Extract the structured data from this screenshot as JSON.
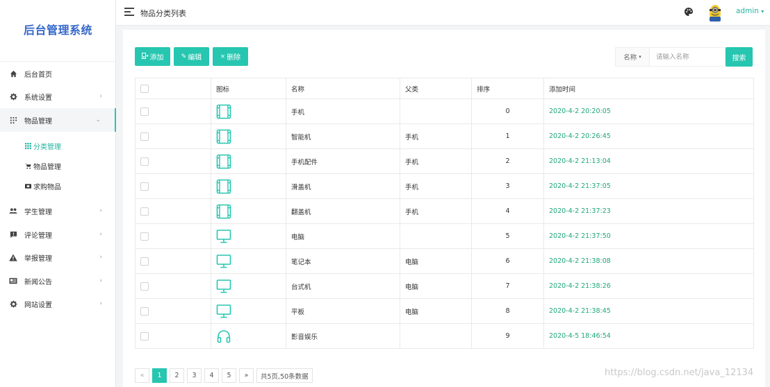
{
  "app": {
    "title": "后台管理系统"
  },
  "sidebar": {
    "items": [
      {
        "label": "后台首页",
        "icon": "home-icon"
      },
      {
        "label": "系统设置",
        "icon": "gear-icon"
      },
      {
        "label": "物品管理",
        "icon": "grid-icon"
      },
      {
        "label": "学生管理",
        "icon": "users-icon"
      },
      {
        "label": "评论管理",
        "icon": "comment-icon"
      },
      {
        "label": "举报管理",
        "icon": "warning-icon"
      },
      {
        "label": "新闻公告",
        "icon": "news-icon"
      },
      {
        "label": "网站设置",
        "icon": "gear-icon"
      }
    ],
    "sub_items": [
      {
        "label": "分类管理",
        "icon": "grid-small-icon"
      },
      {
        "label": "物品管理",
        "icon": "cart-icon"
      },
      {
        "label": "求购物品",
        "icon": "ticket-icon"
      }
    ]
  },
  "header": {
    "title": "物品分类列表",
    "user": "admin"
  },
  "toolbar": {
    "add_label": "添加",
    "edit_label": "编辑",
    "delete_label": "删除"
  },
  "search": {
    "category": "名称",
    "placeholder": "请输入名称",
    "button": "搜索"
  },
  "table": {
    "columns": [
      "图标",
      "名称",
      "父类",
      "排序",
      "添加时间"
    ],
    "rows": [
      {
        "icon": "tablet-icon",
        "name": "手机",
        "parent": "",
        "sort": "0",
        "time": "2020-4-2 20:20:05"
      },
      {
        "icon": "tablet-icon",
        "name": "智能机",
        "parent": "手机",
        "sort": "1",
        "time": "2020-4-2 20:26:45"
      },
      {
        "icon": "tablet-icon",
        "name": "手机配件",
        "parent": "手机",
        "sort": "2",
        "time": "2020-4-2 21:13:04"
      },
      {
        "icon": "tablet-icon",
        "name": "滑盖机",
        "parent": "手机",
        "sort": "3",
        "time": "2020-4-2 21:37:05"
      },
      {
        "icon": "tablet-icon",
        "name": "翻盖机",
        "parent": "手机",
        "sort": "4",
        "time": "2020-4-2 21:37:23"
      },
      {
        "icon": "monitor-icon",
        "name": "电脑",
        "parent": "",
        "sort": "5",
        "time": "2020-4-2 21:37:50"
      },
      {
        "icon": "monitor-icon",
        "name": "笔记本",
        "parent": "电脑",
        "sort": "6",
        "time": "2020-4-2 21:38:08"
      },
      {
        "icon": "monitor-icon",
        "name": "台式机",
        "parent": "电脑",
        "sort": "7",
        "time": "2020-4-2 21:38:26"
      },
      {
        "icon": "monitor-icon",
        "name": "平板",
        "parent": "电脑",
        "sort": "8",
        "time": "2020-4-2 21:38:45"
      },
      {
        "icon": "headphones-icon",
        "name": "影音娱乐",
        "parent": "",
        "sort": "9",
        "time": "2020-4-5 18:46:54"
      }
    ]
  },
  "pagination": {
    "prev": "«",
    "pages": [
      "1",
      "2",
      "3",
      "4",
      "5"
    ],
    "next": "»",
    "summary": "共5页,50条数据",
    "current": "1"
  },
  "watermark": "https://blog.csdn.net/java_12134",
  "colors": {
    "accent": "#26c6b0",
    "brand": "#3567c9",
    "time": "#1fa67a"
  }
}
